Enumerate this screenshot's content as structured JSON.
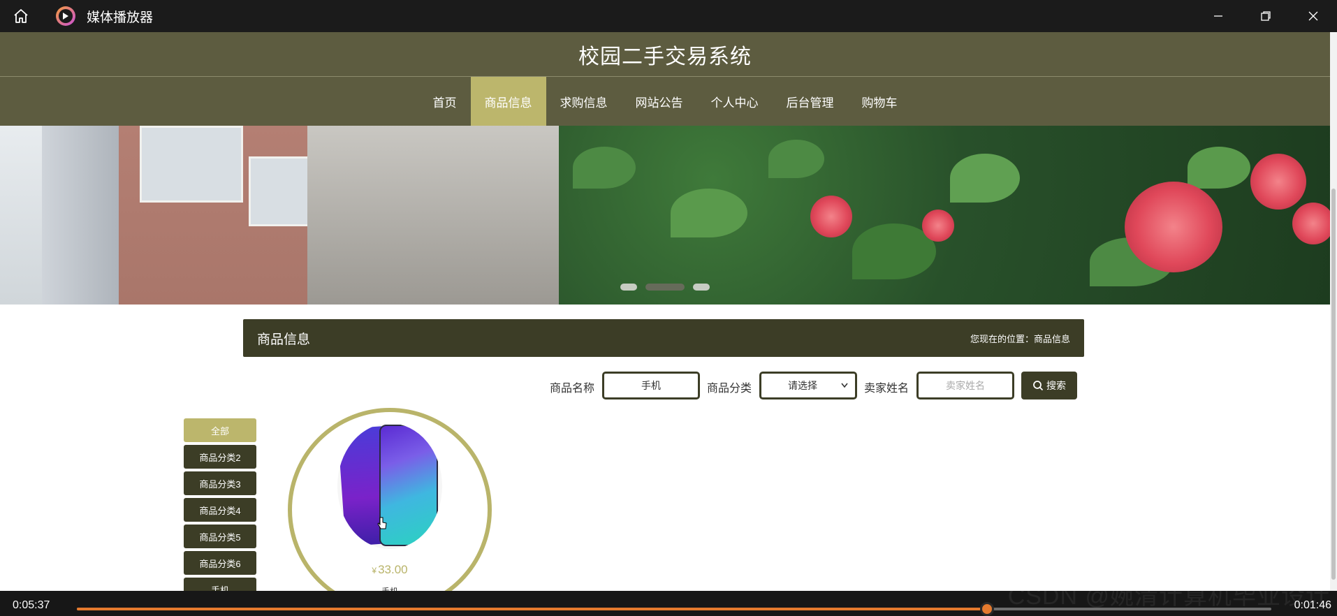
{
  "player": {
    "title": "媒体播放器",
    "time_elapsed": "0:05:37",
    "time_remaining": "0:01:46",
    "progress": 0.762,
    "accent": "#e57a2e"
  },
  "site": {
    "title": "校园二手交易系统",
    "nav": [
      {
        "label": "首页"
      },
      {
        "label": "商品信息"
      },
      {
        "label": "求购信息"
      },
      {
        "label": "网站公告"
      },
      {
        "label": "个人中心"
      },
      {
        "label": "后台管理"
      },
      {
        "label": "购物车"
      }
    ],
    "active_nav": "商品信息",
    "colors": {
      "header": "#5d5c40",
      "active": "#bcb66c",
      "dark": "#3c3d26"
    }
  },
  "section": {
    "title": "商品信息",
    "breadcrumb": "您现在的位置：商品信息"
  },
  "search": {
    "name_label": "商品名称",
    "name_value": "手机",
    "category_label": "商品分类",
    "category_value": "请选择",
    "seller_label": "卖家姓名",
    "seller_placeholder": "卖家姓名",
    "button": "搜索"
  },
  "categories": [
    {
      "label": "全部"
    },
    {
      "label": "商品分类2"
    },
    {
      "label": "商品分类3"
    },
    {
      "label": "商品分类4"
    },
    {
      "label": "商品分类5"
    },
    {
      "label": "商品分类6"
    },
    {
      "label": "手机"
    }
  ],
  "products": [
    {
      "price_symbol": "¥",
      "price": "33.00",
      "name": "手机"
    }
  ],
  "watermark": "CSDN @婉清计算机毕业设计"
}
